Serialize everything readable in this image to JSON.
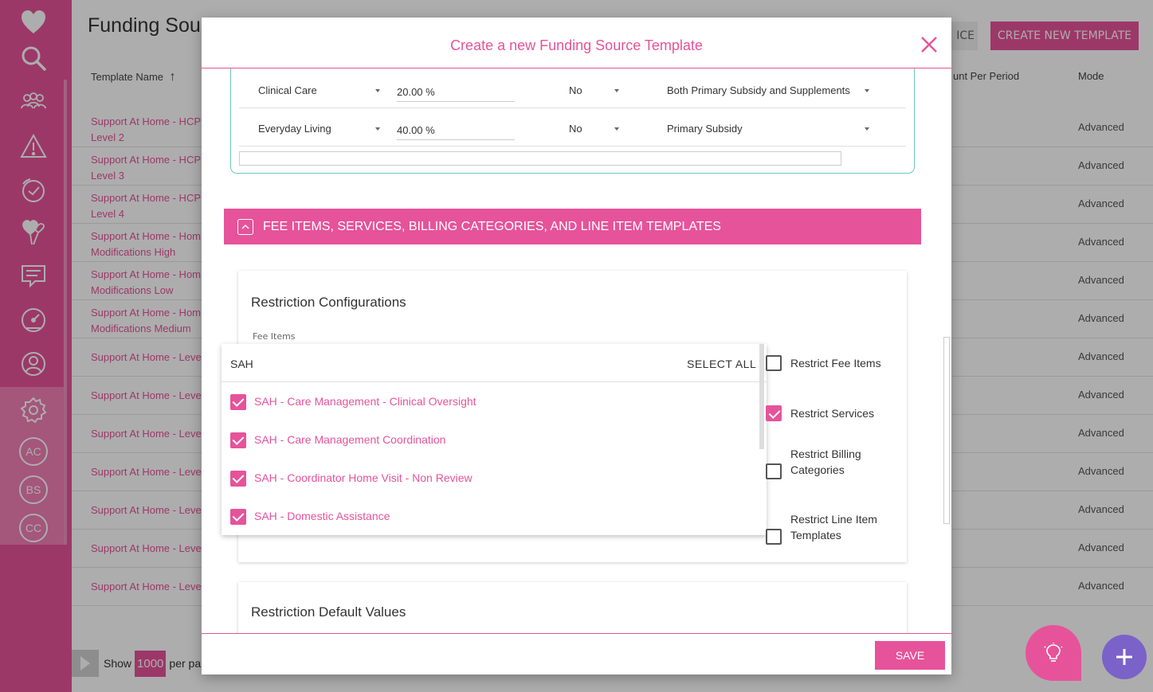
{
  "page": {
    "title": "Funding Sou",
    "buttons": {
      "ice_label": "ICE",
      "create_label": "CREATE NEW TEMPLATE"
    },
    "columns": {
      "template_name": "Template Name",
      "amount_per_period": "unt Per Period",
      "mode": "Mode"
    },
    "rows": [
      {
        "name": "Support At Home - HCP",
        "name2": "Level 2",
        "mode": "Advanced"
      },
      {
        "name": "Support At Home - HCP",
        "name2": "Level 3",
        "mode": "Advanced"
      },
      {
        "name": "Support At Home - HCP",
        "name2": "Level 4",
        "mode": "Advanced"
      },
      {
        "name": "Support At Home - Hom",
        "name2": "Modifications High",
        "mode": "Advanced"
      },
      {
        "name": "Support At Home - Hom",
        "name2": "Modifications Low",
        "mode": "Advanced"
      },
      {
        "name": "Support At Home - Hom",
        "name2": "Modifications Medium",
        "mode": "Advanced"
      },
      {
        "name": "Support At Home - Leve",
        "name2": "",
        "mode": "Advanced"
      },
      {
        "name": "Support At Home - Leve",
        "name2": "",
        "mode": "Advanced"
      },
      {
        "name": "Support At Home - Leve",
        "name2": "",
        "mode": "Advanced"
      },
      {
        "name": "Support At Home - Leve",
        "name2": "",
        "mode": "Advanced"
      },
      {
        "name": "Support At Home - Leve",
        "name2": "",
        "mode": "Advanced"
      },
      {
        "name": "Support At Home - Leve",
        "name2": "",
        "mode": "Advanced"
      },
      {
        "name": "Support At Home - Leve",
        "name2": "",
        "mode": "Advanced"
      }
    ],
    "pager": {
      "show": "Show",
      "per_page_value": "1000",
      "per_page_text": "per pa"
    }
  },
  "sidebar": {
    "circles": [
      "AC",
      "BS",
      "CC"
    ]
  },
  "modal": {
    "title": "Create a new Funding Source Template",
    "top_rows": [
      {
        "category": "Clinical Care",
        "percent": "20.00 %",
        "flag": "No",
        "subsidy": "Both Primary Subsidy and Supplements"
      },
      {
        "category": "Everyday Living",
        "percent": "40.00 %",
        "flag": "No",
        "subsidy": "Primary Subsidy"
      }
    ],
    "section_title": "FEE ITEMS, SERVICES, BILLING CATEGORIES, AND LINE ITEM TEMPLATES",
    "restriction_configurations": "Restriction Configurations",
    "fee_items_label": "Fee Items",
    "dropdown": {
      "search_value": "SAH",
      "select_all": "SELECT ALL",
      "items": [
        "SAH - Care Management - Clinical Oversight",
        "SAH - Care Management Coordination",
        "SAH - Coordinator Home Visit - Non Review",
        "SAH - Domestic Assistance"
      ]
    },
    "options": {
      "restrict_fee_items": "Restrict Fee Items",
      "restrict_services": "Restrict Services",
      "restrict_billing_categories": "Restrict Billing Categories",
      "restrict_line_item_templates": "Restrict Line Item Templates"
    },
    "restriction_default_values": "Restriction Default Values",
    "save_label": "SAVE"
  },
  "colors": {
    "accent": "#e6539a",
    "fab_purple": "#7a62c9",
    "teal_border": "#6cc6c0"
  }
}
